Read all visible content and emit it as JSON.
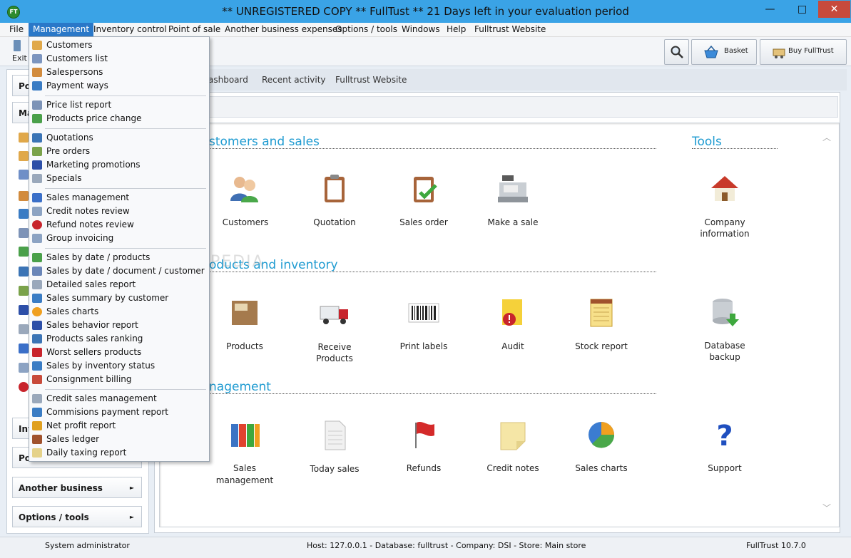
{
  "window": {
    "title": "** UNREGISTERED COPY ** FullTust ** 21 Days left in your evaluation period",
    "app_icon_text": "FT",
    "minimize": "—",
    "maximize": "□",
    "close": "✕"
  },
  "menubar": [
    "File",
    "Management",
    "Inventory control",
    "Point of sale",
    "Another business expenses",
    "Options / tools",
    "Windows",
    "Help",
    "Fulltrust Website"
  ],
  "toolbar": {
    "exit_label": "Exit",
    "basket_label": "Basket",
    "buy_label": "Buy FullTrust"
  },
  "left_panel": {
    "buttons": [
      {
        "label": "Po"
      },
      {
        "label": "Ma"
      },
      {
        "label": "Inv"
      },
      {
        "label": "Po"
      },
      {
        "label": "Another business expenses"
      },
      {
        "label": "Options / tools"
      }
    ],
    "arrow": "►"
  },
  "tabs": [
    "ashboard",
    "Recent activity",
    "Fulltrust Website"
  ],
  "sections": {
    "customers": "stomers and sales",
    "tools": "Tools",
    "products": "oducts and inventory",
    "management": "nagement"
  },
  "tiles": {
    "customers": "Customers",
    "quotation": "Quotation",
    "sales_order": "Sales order",
    "make_sale": "Make a sale",
    "company_info_1": "Company",
    "company_info_2": "information",
    "products": "Products",
    "receive_products_1": "Receive",
    "receive_products_2": "Products",
    "print_labels": "Print labels",
    "audit": "Audit",
    "stock_report": "Stock report",
    "db_backup_1": "Database",
    "db_backup_2": "backup",
    "sales_mgmt_1": "Sales",
    "sales_mgmt_2": "management",
    "today_sales": "Today sales",
    "refunds": "Refunds",
    "credit_notes": "Credit notes",
    "sales_charts": "Sales charts",
    "support": "Support"
  },
  "dropdown": [
    "Customers",
    "Customers list",
    "Salespersons",
    "Payment ways",
    "Price list report",
    "Products price change",
    "Quotations",
    "Pre orders",
    "Marketing promotions",
    "Specials",
    "Sales management",
    "Credit notes review",
    "Refund notes review",
    "Group invoicing",
    "Sales by date / products",
    "Sales by date / document / customer",
    "Detailed sales report",
    "Sales summary by customer",
    "Sales charts",
    "Sales behavior report",
    "Products sales ranking",
    "Worst sellers products",
    "Sales by inventory status",
    "Consignment billing",
    "Credit sales management",
    "Commisions payment report",
    "Net profit report",
    "Sales ledger",
    "Daily taxing report"
  ],
  "watermark": "SOFTPEDIA",
  "status": {
    "user": "System administrator",
    "info": "Host: 127.0.0.1 - Database: fulltrust - Company: DSI - Store: Main store",
    "version": "FullTrust 10.7.0"
  }
}
